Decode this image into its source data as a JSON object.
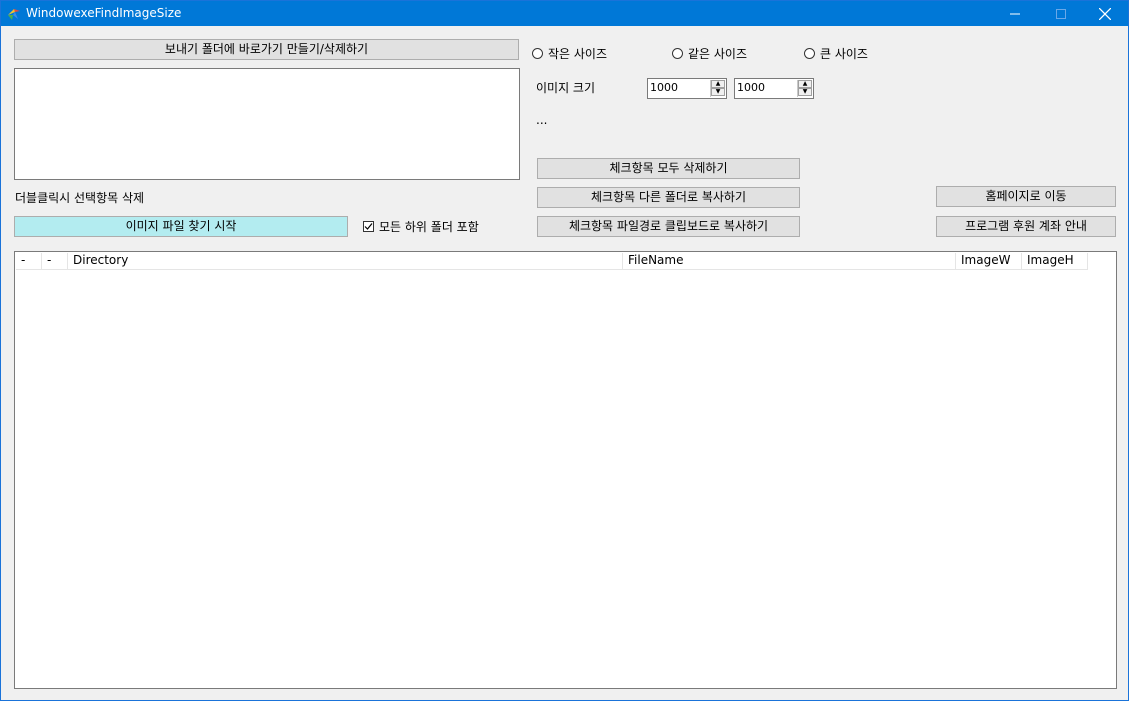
{
  "window": {
    "title": "WindowexeFindImageSize",
    "accent": "#0078d7"
  },
  "titlebar": {
    "minimize_icon": "minimize-icon",
    "maximize_icon": "maximize-icon",
    "close_icon": "close-icon"
  },
  "left": {
    "sendto_button": "보내기 폴더에 바로가기 만들기/삭제하기",
    "hint_label": "더블클릭시 선택항목 삭제",
    "start_button": "이미지 파일 찾기 시작",
    "subfolder_checkbox": "모든 하위 폴더 포함",
    "subfolder_checked": true
  },
  "size_options": {
    "small": "작은 사이즈",
    "same": "같은 사이즈",
    "large": "큰 사이즈",
    "size_label": "이미지 크기",
    "width_value": "1000",
    "height_value": "1000",
    "ellipsis": "..."
  },
  "actions": {
    "delete_all": "체크항목 모두 삭제하기",
    "copy_to_folder": "체크항목 다른 폴더로 복사하기",
    "copy_path": "체크항목 파일경로 클립보드로 복사하기",
    "homepage": "홈페이지로 이동",
    "donate": "프로그램 후원 계좌 안내"
  },
  "list": {
    "columns": [
      "-",
      "-",
      "Directory",
      "FileName",
      "ImageW",
      "ImageH"
    ],
    "rows": []
  },
  "colors": {
    "start_button": "#b3ecf0",
    "background": "#f0f0f0"
  }
}
